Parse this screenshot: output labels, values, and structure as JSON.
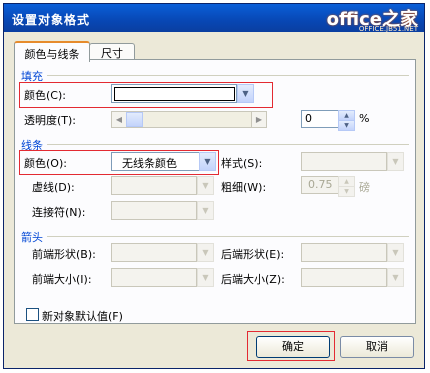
{
  "window": {
    "title": "设置对象格式"
  },
  "watermark": {
    "main": "office之家",
    "sub": "OFFICE.JB51.NET"
  },
  "tabs": [
    {
      "label": "颜色与线条"
    },
    {
      "label": "尺寸"
    }
  ],
  "fill": {
    "section": "填充",
    "color_label": "颜色(C):",
    "transparency_label": "透明度(T):",
    "transparency_value": "0",
    "percent": "%"
  },
  "line": {
    "section": "线条",
    "color_label": "颜色(O):",
    "color_value": "无线条颜色",
    "style_label": "样式(S):",
    "dash_label": "虚线(D):",
    "weight_label": "粗细(W):",
    "weight_value": "0.75",
    "weight_unit": "磅",
    "connector_label": "连接符(N):"
  },
  "arrows": {
    "section": "箭头",
    "begin_style_label": "前端形状(B):",
    "end_style_label": "后端形状(E):",
    "begin_size_label": "前端大小(I):",
    "end_size_label": "后端大小(Z):"
  },
  "default_checkbox": {
    "label": "新对象默认值(F)",
    "checked": false
  },
  "buttons": {
    "ok": "确定",
    "cancel": "取消"
  },
  "colors": {
    "highlight": "#e32a32",
    "title_bar": "#0847b4",
    "section_text": "#0046d5"
  }
}
